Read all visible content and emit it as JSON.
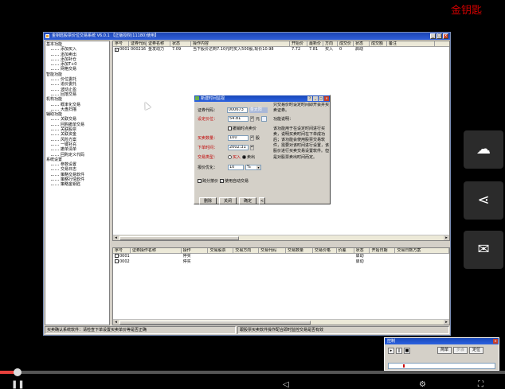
{
  "watermark": "金钥匙",
  "window": {
    "title": "金钥匙股票价位交易系统 V6.0.1 【正版授权(11180)使用】",
    "buttons": [
      "_",
      "□",
      "×"
    ]
  },
  "tree": [
    {
      "group": "基本功能",
      "items": [
        "添加买入",
        "添加卖出",
        "添加补仓",
        "添加T+0",
        "网格交易"
      ]
    },
    {
      "group": "智能功能",
      "items": [
        "价位委托",
        "追价委托",
        "波动止盈",
        "回落交易"
      ]
    },
    {
      "group": "机构功能",
      "items": [
        "概率化交易",
        "大盘扫描"
      ]
    },
    {
      "group": "辅助功能",
      "items": [
        "关联交易",
        "回购撤单交易",
        "关联股票",
        "关联资金",
        "风险方案",
        "一键补充",
        "撤单清单",
        "回购定义代码"
      ]
    },
    {
      "group": "系统设置",
      "items": [
        "参数设置",
        "交易日志",
        "策略交易软件",
        "策略行情软件",
        "策略金钥匙"
      ]
    }
  ],
  "top_table": {
    "columns": [
      "序号",
      "证券代码",
      "证券名称",
      "状态",
      "操作内容",
      "开始价",
      "最新价",
      "方向",
      "成交价",
      "状态",
      "成交额",
      "备注"
    ],
    "rows": [
      [
        "0001",
        "000216",
        "金发动力",
        "7.09",
        "当下股价达到7.10元时买入500股,现价10.98",
        "7.72",
        "7.81",
        "买入",
        "0",
        "启动",
        "",
        ""
      ]
    ]
  },
  "bottom_table": {
    "columns": [
      "序号",
      "证券操作名称",
      "操作",
      "交易股票",
      "交易方向",
      "交易代码",
      "交易数量",
      "交易价格",
      "价差",
      "状态",
      "开始日期",
      "交易日数方案"
    ],
    "rows": [
      [
        "0001",
        "",
        "停买",
        "",
        "",
        "",
        "",
        "",
        "",
        "启动",
        "",
        ""
      ],
      [
        "0002",
        "",
        "停买",
        "",
        "",
        "",
        "",
        "",
        "",
        "启动",
        "",
        ""
      ]
    ]
  },
  "statusbar": {
    "left": "买卖确认系统软件：请检查下单设置买卖单价等是否正确",
    "right": "跟股票买卖软件操作配合即时监控交易是否有效"
  },
  "dialog": {
    "title": "新建时间监视",
    "title_buttons": [
      "?",
      "_",
      "□",
      "×"
    ],
    "fields": {
      "code_label": "证券代码：",
      "code_value": "000673",
      "code_name": "金太阳",
      "price_label": "设定价位：",
      "price_value": "54.81",
      "price_unit": "元",
      "cancel_check_label": "撤销时点卖价",
      "qty_label": "买卖数量：",
      "qty_value": "100",
      "qty_unit": "股",
      "time_label": "下单时间：",
      "time_value": "2002:31",
      "direction_label": "交易类型：",
      "direction_buy": "买入",
      "direction_sell": "卖出",
      "optimize_label": "报价优化：",
      "optimize_value": "10",
      "optimize_unit": "%",
      "jump_label": "跨分按价",
      "auto_label": "使用自动交易"
    },
    "buttons": [
      "删除",
      "关闭",
      "确定",
      "<"
    ],
    "help": [
      "只交易价时设定时间即开会并买卖证券。",
      "功能说明：",
      "该功能用于在设定时间进行买卖，说明买卖时间在下单成功后；该功能会使用股票交易软件，需要对该时间进行设置，该股价进行买卖交易设置软件。但是对股票卖出时间而定。"
    ]
  },
  "mini_window": {
    "title": "控制",
    "buttons": [
      "简单",
      "步骤",
      "定位"
    ]
  },
  "player": {
    "progress": 0.034
  }
}
